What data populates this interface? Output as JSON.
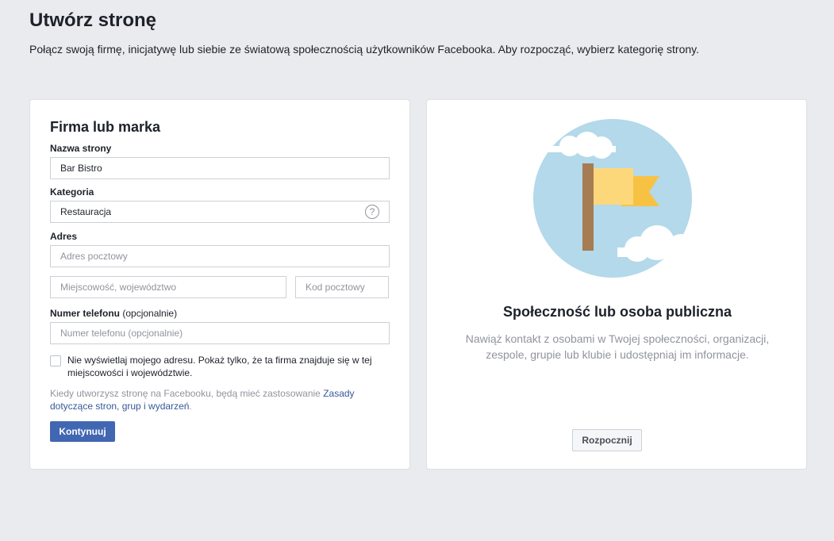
{
  "header": {
    "title": "Utwórz stronę",
    "subtitle": "Połącz swoją firmę, inicjatywę lub siebie ze światową społecznością użytkowników Facebooka. Aby rozpocząć, wybierz kategorię strony."
  },
  "business_card": {
    "heading": "Firma lub marka",
    "page_name_label": "Nazwa strony",
    "page_name_value": "Bar Bistro",
    "category_label": "Kategoria",
    "category_value": "Restauracja",
    "help_glyph": "?",
    "address_label": "Adres",
    "street_placeholder": "Adres pocztowy",
    "city_placeholder": "Miejscowość, województwo",
    "zip_placeholder": "Kod pocztowy",
    "phone_label": "Numer telefonu",
    "phone_label_optional": "(opcjonalnie)",
    "phone_placeholder": "Numer telefonu (opcjonalnie)",
    "hide_address_label": "Nie wyświetlaj mojego adresu. Pokaż tylko, że ta firma znajduje się w tej miejscowości i województwie.",
    "hide_address_checked": false,
    "terms_prefix": "Kiedy utworzysz stronę na Facebooku, będą mieć zastosowanie",
    "terms_link": "Zasady dotyczące stron, grup i wydarzeń",
    "terms_suffix": ".",
    "continue_button": "Kontynuuj"
  },
  "community_card": {
    "title": "Społeczność lub osoba publiczna",
    "description": "Nawiąż kontakt z osobami w Twojej społeczności, organizacji, zespole, grupie lub klubie i udostępniaj im informacje.",
    "start_button": "Rozpocznij",
    "illustration": "flag-illustration"
  },
  "colors": {
    "background": "#e9ebee",
    "primary_button": "#4267b2",
    "link": "#365899",
    "muted_text": "#90949c",
    "circle": "#b3d9ea",
    "flag_pole": "#a67c52",
    "flag_front": "#fdd87b",
    "flag_back": "#f7c244"
  }
}
